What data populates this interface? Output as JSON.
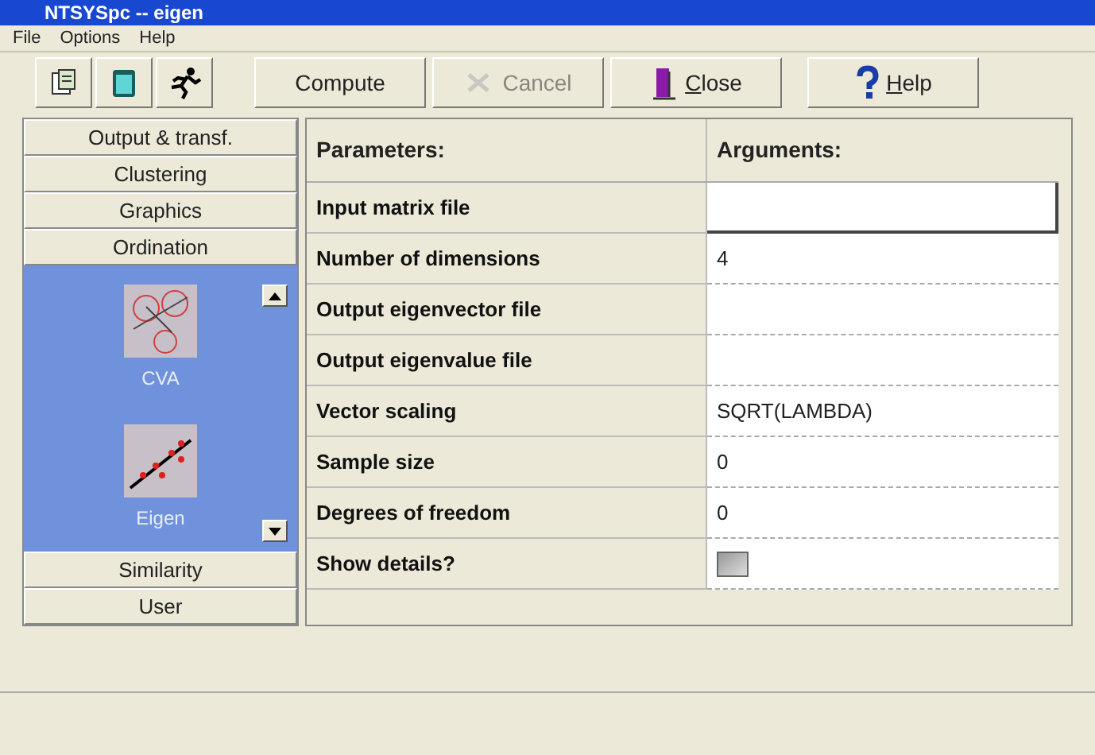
{
  "window": {
    "title": "NTSYSpc -- eigen"
  },
  "menu": [
    "File",
    "Options",
    "Help"
  ],
  "toolbar": {
    "icon_buttons": [
      {
        "kind": "open"
      },
      {
        "kind": "clipboard"
      },
      {
        "kind": "run"
      }
    ],
    "buttons": [
      {
        "label": "Compute",
        "disabled": false,
        "kind": "plain",
        "underline_first": false
      },
      {
        "label": "Cancel",
        "disabled": true,
        "kind": "cancel",
        "underline_first": false
      },
      {
        "label": "Close",
        "disabled": false,
        "kind": "close",
        "underline_first": true
      },
      {
        "label": "Help",
        "disabled": false,
        "kind": "help",
        "underline_first": true
      }
    ]
  },
  "sidebar": {
    "groups_above": [
      {
        "label": "Output & transf."
      },
      {
        "label": "Clustering"
      },
      {
        "label": "Graphics"
      },
      {
        "label": "Ordination"
      }
    ],
    "tools": [
      {
        "label": "CVA",
        "kind": "cva"
      },
      {
        "label": "Eigen",
        "kind": "eigen"
      }
    ],
    "groups_below": [
      {
        "label": "Similarity"
      },
      {
        "label": "User"
      }
    ]
  },
  "table": {
    "columns": [
      "Parameters:",
      "Arguments:"
    ],
    "rows": [
      {
        "parameter": "Input matrix file",
        "kind": "field",
        "value": ""
      },
      {
        "parameter": "Number of dimensions",
        "kind": "text",
        "value": "4"
      },
      {
        "parameter": "Output eigenvector file",
        "kind": "text",
        "value": ""
      },
      {
        "parameter": "Output eigenvalue file",
        "kind": "text",
        "value": ""
      },
      {
        "parameter": "Vector scaling",
        "kind": "text",
        "value": "SQRT(LAMBDA)"
      },
      {
        "parameter": "Sample size",
        "kind": "text",
        "value": "0"
      },
      {
        "parameter": "Degrees of freedom",
        "kind": "text",
        "value": "0"
      },
      {
        "parameter": "Show details?",
        "kind": "checkbox",
        "checked": false
      }
    ]
  }
}
